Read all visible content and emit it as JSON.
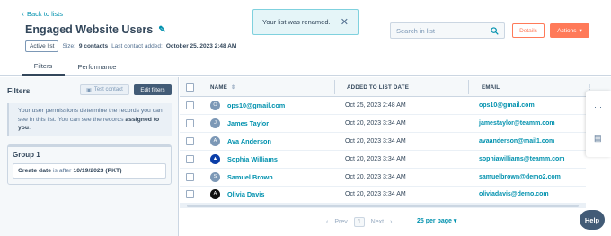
{
  "header": {
    "back_label": "Back to lists",
    "title": "Engaged Website Users",
    "status_badge": "Active list",
    "size_label": "Size:",
    "size_value": "9 contacts",
    "last_contact_label": "Last contact added:",
    "last_contact_value": "October 25, 2023 2:48 AM"
  },
  "toast": {
    "message": "Your list was renamed."
  },
  "search": {
    "placeholder": "Search in list"
  },
  "buttons": {
    "details": "Details",
    "actions": "Actions"
  },
  "tabs": [
    {
      "label": "Filters",
      "active": true
    },
    {
      "label": "Performance",
      "active": false
    }
  ],
  "filters_panel": {
    "title": "Filters",
    "test_contact": "Test contact",
    "edit_filters": "Edit filters",
    "perm_note_text": "Your user permissions determine the records you can see in this list. You can see the records",
    "perm_note_bold": "assigned to you",
    "group_title": "Group 1",
    "criteria_property": "Create date",
    "criteria_operator": "is after",
    "criteria_value": "10/19/2023 (PKT)"
  },
  "table": {
    "columns": [
      "NAME",
      "ADDED TO LIST DATE",
      "EMAIL"
    ],
    "rows": [
      {
        "avatar": "O",
        "avatar_style": "grey",
        "name": "ops10@gmail.com",
        "date": "Oct 25, 2023 2:48 AM",
        "email": "ops10@gmail.com"
      },
      {
        "avatar": "J",
        "avatar_style": "grey",
        "name": "James Taylor",
        "date": "Oct 20, 2023 3:34 AM",
        "email": "jamestaylor@teamm.com"
      },
      {
        "avatar": "A",
        "avatar_style": "grey",
        "name": "Ava Anderson",
        "date": "Oct 20, 2023 3:34 AM",
        "email": "avaanderson@mail1.com"
      },
      {
        "avatar": "▲",
        "avatar_style": "blue",
        "name": "Sophia Williams",
        "date": "Oct 20, 2023 3:34 AM",
        "email": "sophiawilliams@teamm.com"
      },
      {
        "avatar": "S",
        "avatar_style": "grey",
        "name": "Samuel Brown",
        "date": "Oct 20, 2023 3:34 AM",
        "email": "samuelbrown@demo2.com"
      },
      {
        "avatar": "A",
        "avatar_style": "dark",
        "name": "Olivia Davis",
        "date": "Oct 20, 2023 3:34 AM",
        "email": "oliviadavis@demo.com"
      }
    ]
  },
  "pagination": {
    "prev": "Prev",
    "current_page": "1",
    "next": "Next",
    "per_page": "25 per page"
  },
  "help": {
    "label": "Help"
  },
  "colors": {
    "accent": "#ff7a59",
    "link": "#0091ae",
    "dark_button": "#425b76",
    "toast_bg": "#e5f5f8"
  }
}
